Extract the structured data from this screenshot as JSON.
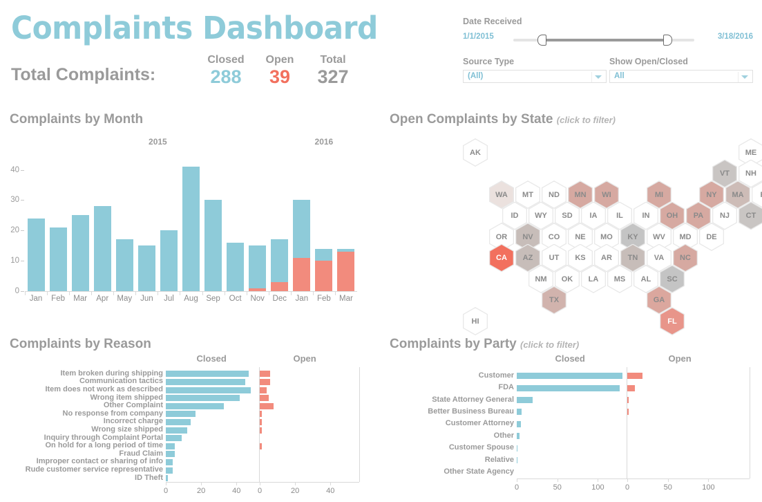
{
  "header": {
    "title": "Complaints Dashboard",
    "total_label": "Total Complaints:",
    "kpis": [
      {
        "label": "Closed",
        "value": "288",
        "color": "#8ecbd9"
      },
      {
        "label": "Open",
        "value": "39",
        "color": "#f2705e"
      },
      {
        "label": "Total",
        "value": "327",
        "color": "#9a9a9a"
      }
    ]
  },
  "filters": {
    "date": {
      "label": "Date Received",
      "min": "1/1/2015",
      "max": "3/18/2016",
      "handle_left_pct": 15,
      "handle_right_pct": 85
    },
    "source_type": {
      "label": "Source Type",
      "value": "(All)"
    },
    "show_open_closed": {
      "label": "Show Open/Closed",
      "value": "All"
    }
  },
  "month_chart": {
    "title": "Complaints by Month",
    "years": [
      "2015",
      "2016"
    ]
  },
  "state_map": {
    "title": "Open Complaints by State",
    "hint": "(click to filter)"
  },
  "reason_chart": {
    "title": "Complaints by Reason",
    "closed_header": "Closed",
    "open_header": "Open"
  },
  "party_chart": {
    "title": "Complaints by Party",
    "hint": "(click to filter)",
    "closed_header": "Closed",
    "open_header": "Open"
  },
  "colors": {
    "blue": "#8ecbd9",
    "salmon": "#f28b7d",
    "red_text": "#f2705e",
    "gray_text": "#9a9a9a",
    "hex_empty": "#ffffff",
    "hex_border": "#e8e8e8"
  },
  "chart_data": [
    {
      "type": "bar",
      "id": "complaints-by-month",
      "title": "Complaints by Month",
      "stacked": true,
      "categories": [
        "Jan",
        "Feb",
        "Mar",
        "Apr",
        "May",
        "Jun",
        "Jul",
        "Aug",
        "Sep",
        "Oct",
        "Nov",
        "Dec",
        "Jan",
        "Feb",
        "Mar"
      ],
      "group_labels": [
        "2015",
        "2016"
      ],
      "group_spans": [
        12,
        3
      ],
      "series": [
        {
          "name": "Closed",
          "color": "#8ecbd9",
          "values": [
            24,
            21,
            25,
            28,
            17,
            15,
            20,
            41,
            30,
            16,
            14,
            14,
            19,
            4,
            1
          ]
        },
        {
          "name": "Open",
          "color": "#f28b7d",
          "values": [
            0,
            0,
            0,
            0,
            0,
            0,
            0,
            0,
            0,
            0,
            1,
            3,
            11,
            10,
            13
          ]
        }
      ],
      "totals": [
        24,
        21,
        25,
        28,
        17,
        15,
        20,
        41,
        30,
        16,
        15,
        17,
        30,
        14,
        14
      ],
      "xlabel": "",
      "ylabel": "",
      "ylim": [
        0,
        44
      ],
      "yticks": [
        0,
        10,
        20,
        30,
        40
      ],
      "grid": false,
      "legend": "none"
    },
    {
      "type": "heatmap",
      "id": "open-complaints-by-state",
      "title": "Open Complaints by State",
      "subtitle": "(click to filter)",
      "layout": "hex-tile-grid",
      "note": "intensity = number of open complaints; white = none",
      "states": [
        {
          "code": "AK",
          "row": 0,
          "col": 0,
          "level": 0,
          "fill": "#ffffff"
        },
        {
          "code": "ME",
          "row": 0,
          "col": 10.5,
          "level": 0,
          "fill": "#ffffff"
        },
        {
          "code": "VT",
          "row": 1,
          "col": 9.5,
          "level": 2,
          "fill": "#c9c5c3"
        },
        {
          "code": "NH",
          "row": 1,
          "col": 10.5,
          "level": 0,
          "fill": "#ffffff"
        },
        {
          "code": "WA",
          "row": 2,
          "col": 1,
          "level": 1,
          "fill": "#ebe1de"
        },
        {
          "code": "MT",
          "row": 2,
          "col": 2,
          "level": 0,
          "fill": "#ffffff"
        },
        {
          "code": "ND",
          "row": 2,
          "col": 3,
          "level": 0,
          "fill": "#ffffff"
        },
        {
          "code": "MN",
          "row": 2,
          "col": 4,
          "level": 4,
          "fill": "#d6a9a1"
        },
        {
          "code": "WI",
          "row": 2,
          "col": 5,
          "level": 4,
          "fill": "#d6a9a1"
        },
        {
          "code": "MI",
          "row": 2,
          "col": 7,
          "level": 4,
          "fill": "#d6a9a1"
        },
        {
          "code": "NY",
          "row": 2,
          "col": 9,
          "level": 4,
          "fill": "#d6a9a1"
        },
        {
          "code": "MA",
          "row": 2,
          "col": 10,
          "level": 3,
          "fill": "#cdbcb7"
        },
        {
          "code": "RI",
          "row": 2,
          "col": 11,
          "level": 0,
          "fill": "#ffffff"
        },
        {
          "code": "ID",
          "row": 3,
          "col": 1.5,
          "level": 0,
          "fill": "#ffffff"
        },
        {
          "code": "WY",
          "row": 3,
          "col": 2.5,
          "level": 0,
          "fill": "#ffffff"
        },
        {
          "code": "SD",
          "row": 3,
          "col": 3.5,
          "level": 0,
          "fill": "#ffffff"
        },
        {
          "code": "IA",
          "row": 3,
          "col": 4.5,
          "level": 0,
          "fill": "#ffffff"
        },
        {
          "code": "IL",
          "row": 3,
          "col": 5.5,
          "level": 0,
          "fill": "#ffffff"
        },
        {
          "code": "IN",
          "row": 3,
          "col": 6.5,
          "level": 0,
          "fill": "#ffffff"
        },
        {
          "code": "OH",
          "row": 3,
          "col": 7.5,
          "level": 4,
          "fill": "#d6a9a1"
        },
        {
          "code": "PA",
          "row": 3,
          "col": 8.5,
          "level": 4,
          "fill": "#d6a9a1"
        },
        {
          "code": "NJ",
          "row": 3,
          "col": 9.5,
          "level": 0,
          "fill": "#ffffff"
        },
        {
          "code": "CT",
          "row": 3,
          "col": 10.5,
          "level": 2,
          "fill": "#c9c5c3"
        },
        {
          "code": "OR",
          "row": 4,
          "col": 1,
          "level": 0,
          "fill": "#ffffff"
        },
        {
          "code": "NV",
          "row": 4,
          "col": 2,
          "level": 3,
          "fill": "#c7bdb9"
        },
        {
          "code": "CO",
          "row": 4,
          "col": 3,
          "level": 0,
          "fill": "#ffffff"
        },
        {
          "code": "NE",
          "row": 4,
          "col": 4,
          "level": 0,
          "fill": "#ffffff"
        },
        {
          "code": "MO",
          "row": 4,
          "col": 5,
          "level": 0,
          "fill": "#ffffff"
        },
        {
          "code": "KY",
          "row": 4,
          "col": 6,
          "level": 2,
          "fill": "#c4c4c4"
        },
        {
          "code": "WV",
          "row": 4,
          "col": 7,
          "level": 0,
          "fill": "#ffffff"
        },
        {
          "code": "MD",
          "row": 4,
          "col": 8,
          "level": 0,
          "fill": "#ffffff"
        },
        {
          "code": "DE",
          "row": 4,
          "col": 9,
          "level": 0,
          "fill": "#ffffff"
        },
        {
          "code": "CA",
          "row": 5,
          "col": 1,
          "level": 6,
          "fill": "#f2705e"
        },
        {
          "code": "AZ",
          "row": 5,
          "col": 2,
          "level": 3,
          "fill": "#c7bdb9"
        },
        {
          "code": "UT",
          "row": 5,
          "col": 3,
          "level": 0,
          "fill": "#ffffff"
        },
        {
          "code": "KS",
          "row": 5,
          "col": 4,
          "level": 0,
          "fill": "#ffffff"
        },
        {
          "code": "AR",
          "row": 5,
          "col": 5,
          "level": 0,
          "fill": "#ffffff"
        },
        {
          "code": "TN",
          "row": 5,
          "col": 6,
          "level": 3,
          "fill": "#c7bdb9"
        },
        {
          "code": "VA",
          "row": 5,
          "col": 7,
          "level": 0,
          "fill": "#ffffff"
        },
        {
          "code": "NC",
          "row": 5,
          "col": 8,
          "level": 4,
          "fill": "#d6a9a1"
        },
        {
          "code": "NM",
          "row": 6,
          "col": 2.5,
          "level": 0,
          "fill": "#ffffff"
        },
        {
          "code": "OK",
          "row": 6,
          "col": 3.5,
          "level": 0,
          "fill": "#ffffff"
        },
        {
          "code": "LA",
          "row": 6,
          "col": 4.5,
          "level": 0,
          "fill": "#ffffff"
        },
        {
          "code": "MS",
          "row": 6,
          "col": 5.5,
          "level": 0,
          "fill": "#ffffff"
        },
        {
          "code": "AL",
          "row": 6,
          "col": 6.5,
          "level": 0,
          "fill": "#ffffff"
        },
        {
          "code": "SC",
          "row": 6,
          "col": 7.5,
          "level": 2,
          "fill": "#c4c4c4"
        },
        {
          "code": "TX",
          "row": 7,
          "col": 3,
          "level": 3,
          "fill": "#d1b3ad"
        },
        {
          "code": "GA",
          "row": 7,
          "col": 7,
          "level": 4,
          "fill": "#dba79e"
        },
        {
          "code": "HI",
          "row": 8,
          "col": 0,
          "level": 0,
          "fill": "#ffffff"
        },
        {
          "code": "FL",
          "row": 8,
          "col": 7.5,
          "level": 5,
          "fill": "#e8958a"
        }
      ]
    },
    {
      "type": "bar",
      "id": "complaints-by-reason",
      "title": "Complaints by Reason",
      "orientation": "horizontal-diverging",
      "categories": [
        "Item broken during shipping",
        "Communication tactics",
        "Item does not work as described",
        "Wrong item shipped",
        "Other Complaint",
        "No response from company",
        "Incorrect charge",
        "Wrong size shipped",
        "Inquiry through Complaint Portal",
        "On hold for a long period of time",
        "Fraud Claim",
        "Improper contact or sharing of info",
        "Rude customer service representative",
        "ID Theft"
      ],
      "series": [
        {
          "name": "Closed",
          "color": "#8ecbd9",
          "values": [
            47,
            45,
            48,
            42,
            33,
            17,
            14,
            12,
            9,
            5,
            5,
            4,
            4,
            1
          ]
        },
        {
          "name": "Open",
          "color": "#f28b7d",
          "values": [
            6,
            6,
            4,
            5,
            8,
            1,
            1,
            1,
            0,
            1,
            0,
            0,
            0,
            0
          ]
        }
      ],
      "closed_xticks": [
        0,
        20,
        40
      ],
      "open_xticks": [
        0,
        20,
        40
      ],
      "closed_xlim": [
        0,
        52
      ],
      "open_xlim": [
        0,
        52
      ],
      "grid": false
    },
    {
      "type": "bar",
      "id": "complaints-by-party",
      "title": "Complaints by Party",
      "subtitle": "(click to filter)",
      "orientation": "horizontal-diverging",
      "categories": [
        "Customer",
        "FDA",
        "State Attorney General",
        "Better Business Bureau",
        "Customer Attorney",
        "Other",
        "Customer Spouse",
        "Relative",
        "Other State Agency"
      ],
      "series": [
        {
          "name": "Closed",
          "color": "#8ecbd9",
          "values": [
            130,
            127,
            20,
            6,
            5,
            3,
            1,
            1,
            0
          ]
        },
        {
          "name": "Open",
          "color": "#f28b7d",
          "values": [
            19,
            9,
            1,
            1,
            0,
            0,
            0,
            0,
            0
          ]
        }
      ],
      "closed_xticks": [
        0,
        50,
        100
      ],
      "open_xticks": [
        0,
        50,
        100
      ],
      "closed_xlim": [
        0,
        132
      ],
      "open_xlim": [
        0,
        132
      ],
      "grid": false
    }
  ]
}
